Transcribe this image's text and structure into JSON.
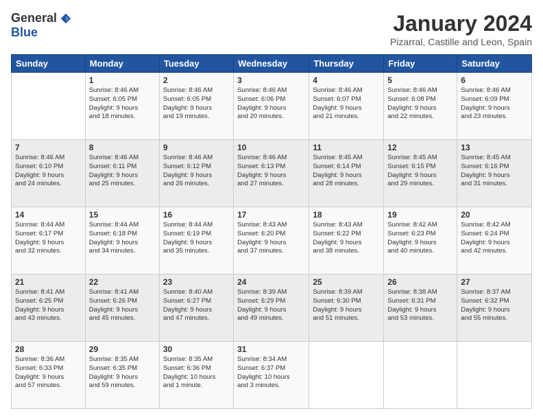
{
  "logo": {
    "general": "General",
    "blue": "Blue"
  },
  "header": {
    "title": "January 2024",
    "subtitle": "Pizarral, Castille and Leon, Spain"
  },
  "days_of_week": [
    "Sunday",
    "Monday",
    "Tuesday",
    "Wednesday",
    "Thursday",
    "Friday",
    "Saturday"
  ],
  "weeks": [
    [
      {
        "day": "",
        "info": ""
      },
      {
        "day": "1",
        "info": "Sunrise: 8:46 AM\nSunset: 6:05 PM\nDaylight: 9 hours\nand 18 minutes."
      },
      {
        "day": "2",
        "info": "Sunrise: 8:46 AM\nSunset: 6:05 PM\nDaylight: 9 hours\nand 19 minutes."
      },
      {
        "day": "3",
        "info": "Sunrise: 8:46 AM\nSunset: 6:06 PM\nDaylight: 9 hours\nand 20 minutes."
      },
      {
        "day": "4",
        "info": "Sunrise: 8:46 AM\nSunset: 6:07 PM\nDaylight: 9 hours\nand 21 minutes."
      },
      {
        "day": "5",
        "info": "Sunrise: 8:46 AM\nSunset: 6:08 PM\nDaylight: 9 hours\nand 22 minutes."
      },
      {
        "day": "6",
        "info": "Sunrise: 8:46 AM\nSunset: 6:09 PM\nDaylight: 9 hours\nand 23 minutes."
      }
    ],
    [
      {
        "day": "7",
        "info": "Sunrise: 8:46 AM\nSunset: 6:10 PM\nDaylight: 9 hours\nand 24 minutes."
      },
      {
        "day": "8",
        "info": "Sunrise: 8:46 AM\nSunset: 6:11 PM\nDaylight: 9 hours\nand 25 minutes."
      },
      {
        "day": "9",
        "info": "Sunrise: 8:46 AM\nSunset: 6:12 PM\nDaylight: 9 hours\nand 26 minutes."
      },
      {
        "day": "10",
        "info": "Sunrise: 8:46 AM\nSunset: 6:13 PM\nDaylight: 9 hours\nand 27 minutes."
      },
      {
        "day": "11",
        "info": "Sunrise: 8:45 AM\nSunset: 6:14 PM\nDaylight: 9 hours\nand 28 minutes."
      },
      {
        "day": "12",
        "info": "Sunrise: 8:45 AM\nSunset: 6:15 PM\nDaylight: 9 hours\nand 29 minutes."
      },
      {
        "day": "13",
        "info": "Sunrise: 8:45 AM\nSunset: 6:16 PM\nDaylight: 9 hours\nand 31 minutes."
      }
    ],
    [
      {
        "day": "14",
        "info": "Sunrise: 8:44 AM\nSunset: 6:17 PM\nDaylight: 9 hours\nand 32 minutes."
      },
      {
        "day": "15",
        "info": "Sunrise: 8:44 AM\nSunset: 6:18 PM\nDaylight: 9 hours\nand 34 minutes."
      },
      {
        "day": "16",
        "info": "Sunrise: 8:44 AM\nSunset: 6:19 PM\nDaylight: 9 hours\nand 35 minutes."
      },
      {
        "day": "17",
        "info": "Sunrise: 8:43 AM\nSunset: 6:20 PM\nDaylight: 9 hours\nand 37 minutes."
      },
      {
        "day": "18",
        "info": "Sunrise: 8:43 AM\nSunset: 6:22 PM\nDaylight: 9 hours\nand 38 minutes."
      },
      {
        "day": "19",
        "info": "Sunrise: 8:42 AM\nSunset: 6:23 PM\nDaylight: 9 hours\nand 40 minutes."
      },
      {
        "day": "20",
        "info": "Sunrise: 8:42 AM\nSunset: 6:24 PM\nDaylight: 9 hours\nand 42 minutes."
      }
    ],
    [
      {
        "day": "21",
        "info": "Sunrise: 8:41 AM\nSunset: 6:25 PM\nDaylight: 9 hours\nand 43 minutes."
      },
      {
        "day": "22",
        "info": "Sunrise: 8:41 AM\nSunset: 6:26 PM\nDaylight: 9 hours\nand 45 minutes."
      },
      {
        "day": "23",
        "info": "Sunrise: 8:40 AM\nSunset: 6:27 PM\nDaylight: 9 hours\nand 47 minutes."
      },
      {
        "day": "24",
        "info": "Sunrise: 8:39 AM\nSunset: 6:29 PM\nDaylight: 9 hours\nand 49 minutes."
      },
      {
        "day": "25",
        "info": "Sunrise: 8:39 AM\nSunset: 6:30 PM\nDaylight: 9 hours\nand 51 minutes."
      },
      {
        "day": "26",
        "info": "Sunrise: 8:38 AM\nSunset: 6:31 PM\nDaylight: 9 hours\nand 53 minutes."
      },
      {
        "day": "27",
        "info": "Sunrise: 8:37 AM\nSunset: 6:32 PM\nDaylight: 9 hours\nand 55 minutes."
      }
    ],
    [
      {
        "day": "28",
        "info": "Sunrise: 8:36 AM\nSunset: 6:33 PM\nDaylight: 9 hours\nand 57 minutes."
      },
      {
        "day": "29",
        "info": "Sunrise: 8:35 AM\nSunset: 6:35 PM\nDaylight: 9 hours\nand 59 minutes."
      },
      {
        "day": "30",
        "info": "Sunrise: 8:35 AM\nSunset: 6:36 PM\nDaylight: 10 hours\nand 1 minute."
      },
      {
        "day": "31",
        "info": "Sunrise: 8:34 AM\nSunset: 6:37 PM\nDaylight: 10 hours\nand 3 minutes."
      },
      {
        "day": "",
        "info": ""
      },
      {
        "day": "",
        "info": ""
      },
      {
        "day": "",
        "info": ""
      }
    ]
  ]
}
